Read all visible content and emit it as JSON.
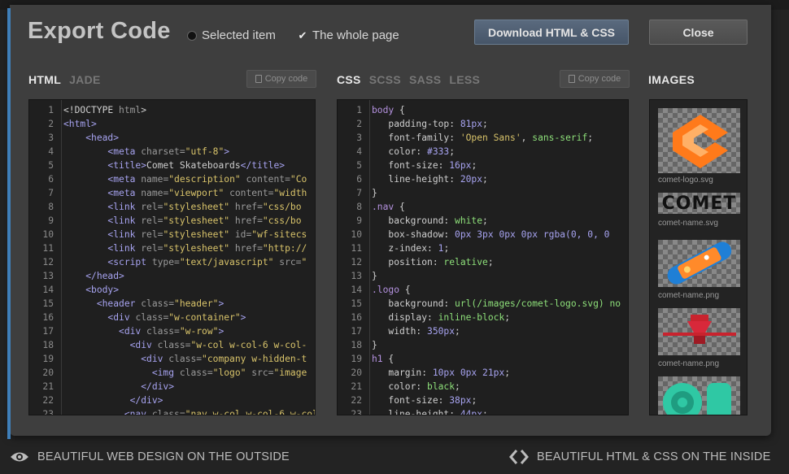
{
  "title": "Export Code",
  "options": {
    "selected_item": "Selected item",
    "whole_page": "The whole page"
  },
  "buttons": {
    "download": "Download HTML & CSS",
    "close": "Close"
  },
  "html_tabs": [
    "HTML",
    "JADE"
  ],
  "css_tabs": [
    "CSS",
    "SCSS",
    "SASS",
    "LESS"
  ],
  "copy_label": "Copy code",
  "images_title": "IMAGES",
  "images": [
    {
      "label": "comet-logo.svg"
    },
    {
      "label": "comet-name.svg"
    },
    {
      "label": "comet-name.png"
    },
    {
      "label": "comet-name.png"
    }
  ],
  "comet_word": "COMET",
  "footer": {
    "left": "BEAUTIFUL WEB DESIGN ON THE OUTSIDE",
    "right": "BEAUTIFUL HTML & CSS ON THE INSIDE"
  },
  "colors": {
    "accent": "#3f7fb9",
    "logo_orange": "#ff7a1a",
    "modal_bg": "#3e3e3e"
  },
  "html_lines": [
    [
      [
        "",
        "<!DOCTYPE "
      ],
      [
        "at",
        "html"
      ],
      [
        "",
        ">"
      ]
    ],
    [
      [
        "tg",
        "<html>"
      ]
    ],
    [
      [
        "",
        "    "
      ],
      [
        "tg",
        "<head>"
      ]
    ],
    [
      [
        "",
        "        "
      ],
      [
        "tg",
        "<meta"
      ],
      [
        "at",
        " charset="
      ],
      [
        "st",
        "\"utf-8\""
      ],
      [
        "tg",
        ">"
      ]
    ],
    [
      [
        "",
        "        "
      ],
      [
        "tg",
        "<title>"
      ],
      [
        "",
        "Comet Skateboards"
      ],
      [
        "tg",
        "</title>"
      ]
    ],
    [
      [
        "",
        "        "
      ],
      [
        "tg",
        "<meta"
      ],
      [
        "at",
        " name="
      ],
      [
        "st",
        "\"description\""
      ],
      [
        "at",
        " content="
      ],
      [
        "st",
        "\"Co"
      ]
    ],
    [
      [
        "",
        "        "
      ],
      [
        "tg",
        "<meta"
      ],
      [
        "at",
        " name="
      ],
      [
        "st",
        "\"viewport\""
      ],
      [
        "at",
        " content="
      ],
      [
        "st",
        "\"width"
      ]
    ],
    [
      [
        "",
        "        "
      ],
      [
        "tg",
        "<link"
      ],
      [
        "at",
        " rel="
      ],
      [
        "st",
        "\"stylesheet\""
      ],
      [
        "at",
        " href="
      ],
      [
        "st",
        "\"css/bo"
      ]
    ],
    [
      [
        "",
        "        "
      ],
      [
        "tg",
        "<link"
      ],
      [
        "at",
        " rel="
      ],
      [
        "st",
        "\"stylesheet\""
      ],
      [
        "at",
        " href="
      ],
      [
        "st",
        "\"css/bo"
      ]
    ],
    [
      [
        "",
        "        "
      ],
      [
        "tg",
        "<link"
      ],
      [
        "at",
        " rel="
      ],
      [
        "st",
        "\"stylesheet\""
      ],
      [
        "at",
        " id="
      ],
      [
        "st",
        "\"wf-sitecs"
      ]
    ],
    [
      [
        "",
        "        "
      ],
      [
        "tg",
        "<link"
      ],
      [
        "at",
        " rel="
      ],
      [
        "st",
        "\"stylesheet\""
      ],
      [
        "at",
        " href="
      ],
      [
        "st",
        "\"http://"
      ]
    ],
    [
      [
        "",
        "        "
      ],
      [
        "tg",
        "<script"
      ],
      [
        "at",
        " type="
      ],
      [
        "st",
        "\"text/javascript\""
      ],
      [
        "at",
        " src="
      ],
      [
        "st",
        "\""
      ]
    ],
    [
      [
        "",
        "    "
      ],
      [
        "tg",
        "</head>"
      ]
    ],
    [
      [
        "",
        "    "
      ],
      [
        "tg",
        "<body>"
      ]
    ],
    [
      [
        "",
        "      "
      ],
      [
        "tg",
        "<header"
      ],
      [
        "at",
        " class="
      ],
      [
        "st",
        "\"header\""
      ],
      [
        "tg",
        ">"
      ]
    ],
    [
      [
        "",
        "        "
      ],
      [
        "tg",
        "<div"
      ],
      [
        "at",
        " class="
      ],
      [
        "st",
        "\"w-container\""
      ],
      [
        "tg",
        ">"
      ]
    ],
    [
      [
        "",
        "          "
      ],
      [
        "tg",
        "<div"
      ],
      [
        "at",
        " class="
      ],
      [
        "st",
        "\"w-row\""
      ],
      [
        "tg",
        ">"
      ]
    ],
    [
      [
        "",
        "            "
      ],
      [
        "tg",
        "<div"
      ],
      [
        "at",
        " class="
      ],
      [
        "st",
        "\"w-col w-col-6 w-col-"
      ]
    ],
    [
      [
        "",
        "              "
      ],
      [
        "tg",
        "<div"
      ],
      [
        "at",
        " class="
      ],
      [
        "st",
        "\"company w-hidden-t"
      ]
    ],
    [
      [
        "",
        "                "
      ],
      [
        "tg",
        "<img"
      ],
      [
        "at",
        " class="
      ],
      [
        "st",
        "\"logo\""
      ],
      [
        "at",
        " src="
      ],
      [
        "st",
        "\"image"
      ]
    ],
    [
      [
        "",
        "              "
      ],
      [
        "tg",
        "</div>"
      ]
    ],
    [
      [
        "",
        "            "
      ],
      [
        "tg",
        "</div>"
      ]
    ],
    [
      [
        "",
        "           "
      ],
      [
        "tg",
        "<nav"
      ],
      [
        "at",
        " class="
      ],
      [
        "st",
        "\"nav w-col w-col-6 w-col"
      ]
    ]
  ],
  "css_lines": [
    [
      [
        "sel",
        "body"
      ],
      [
        "",
        " {"
      ]
    ],
    [
      [
        "",
        "   "
      ],
      [
        "pr",
        "padding-top: "
      ],
      [
        "vl",
        "81px"
      ],
      [
        "",
        ";"
      ]
    ],
    [
      [
        "",
        "   "
      ],
      [
        "pr",
        "font-family: "
      ],
      [
        "st",
        "'Open Sans'"
      ],
      [
        "",
        ", "
      ],
      [
        "vs",
        "sans-serif"
      ],
      [
        "",
        ";"
      ]
    ],
    [
      [
        "",
        "   "
      ],
      [
        "pr",
        "color: "
      ],
      [
        "vl",
        "#333"
      ],
      [
        "",
        ";"
      ]
    ],
    [
      [
        "",
        "   "
      ],
      [
        "pr",
        "font-size: "
      ],
      [
        "vl",
        "16px"
      ],
      [
        "",
        ";"
      ]
    ],
    [
      [
        "",
        "   "
      ],
      [
        "pr",
        "line-height: "
      ],
      [
        "vl",
        "20px"
      ],
      [
        "",
        ";"
      ]
    ],
    [
      [
        "",
        "}"
      ]
    ],
    [
      [
        "sel",
        ".nav"
      ],
      [
        "",
        " {"
      ]
    ],
    [
      [
        "",
        "   "
      ],
      [
        "pr",
        "background: "
      ],
      [
        "vs",
        "white"
      ],
      [
        "",
        ";"
      ]
    ],
    [
      [
        "",
        "   "
      ],
      [
        "pr",
        "box-shadow: "
      ],
      [
        "vl",
        "0px 3px 0px 0px rgba(0, 0, 0"
      ]
    ],
    [
      [
        "",
        "   "
      ],
      [
        "pr",
        "z-index: "
      ],
      [
        "vl",
        "1"
      ],
      [
        "",
        ";"
      ]
    ],
    [
      [
        "",
        "   "
      ],
      [
        "pr",
        "position: "
      ],
      [
        "vs",
        "relative"
      ],
      [
        "",
        ";"
      ]
    ],
    [
      [
        "",
        "}"
      ]
    ],
    [
      [
        "sel",
        ".logo"
      ],
      [
        "",
        " {"
      ]
    ],
    [
      [
        "",
        "   "
      ],
      [
        "pr",
        "background: "
      ],
      [
        "vs",
        "url(/images/comet-logo.svg) no"
      ]
    ],
    [
      [
        "",
        "   "
      ],
      [
        "pr",
        "display: "
      ],
      [
        "vs",
        "inline-block"
      ],
      [
        "",
        ";"
      ]
    ],
    [
      [
        "",
        "   "
      ],
      [
        "pr",
        "width: "
      ],
      [
        "vl",
        "350px"
      ],
      [
        "",
        ";"
      ]
    ],
    [
      [
        "",
        "}"
      ]
    ],
    [
      [
        "sel",
        "h1"
      ],
      [
        "",
        " {"
      ]
    ],
    [
      [
        "",
        "   "
      ],
      [
        "pr",
        "margin: "
      ],
      [
        "vl",
        "10px 0px 21px"
      ],
      [
        "",
        ";"
      ]
    ],
    [
      [
        "",
        "   "
      ],
      [
        "pr",
        "color: "
      ],
      [
        "vs",
        "black"
      ],
      [
        "",
        ";"
      ]
    ],
    [
      [
        "",
        "   "
      ],
      [
        "pr",
        "font-size: "
      ],
      [
        "vl",
        "38px"
      ],
      [
        "",
        ";"
      ]
    ],
    [
      [
        "",
        "   "
      ],
      [
        "pr",
        "line-height: "
      ],
      [
        "vl",
        "44px"
      ],
      [
        "",
        ";"
      ]
    ]
  ]
}
